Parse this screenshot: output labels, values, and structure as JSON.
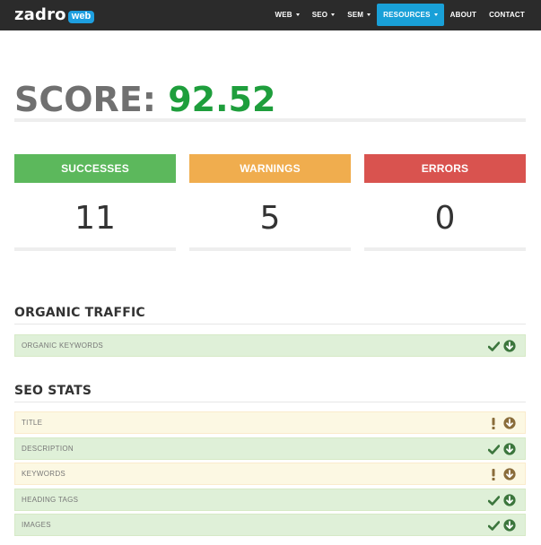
{
  "navbar": {
    "logo_text": "zadro",
    "logo_badge": "web",
    "items": [
      {
        "label": "WEB",
        "dropdown": true,
        "active": false
      },
      {
        "label": "SEO",
        "dropdown": true,
        "active": false
      },
      {
        "label": "SEM",
        "dropdown": true,
        "active": false
      },
      {
        "label": "RESOURCES",
        "dropdown": true,
        "active": true
      },
      {
        "label": "ABOUT",
        "dropdown": false,
        "active": false
      },
      {
        "label": "CONTACT",
        "dropdown": false,
        "active": false
      }
    ],
    "colors": {
      "background": "#2b2b2b",
      "active": "#19a0d8",
      "badge": "#1e9fe0"
    }
  },
  "score": {
    "label": "SCORE:",
    "value": "92.52",
    "colors": {
      "label": "#707070",
      "value": "#1e9e3c"
    }
  },
  "stats": [
    {
      "label": "SUCCESSES",
      "value": "11",
      "color": "#5cb85c"
    },
    {
      "label": "WARNINGS",
      "value": "5",
      "color": "#f0ad4e"
    },
    {
      "label": "ERRORS",
      "value": "0",
      "color": "#d9534f"
    }
  ],
  "sections": [
    {
      "title": "ORGANIC TRAFFIC",
      "rows": [
        {
          "label": "ORGANIC KEYWORDS",
          "status": "success",
          "status_icon": "check-icon",
          "toggle_icon": "expand-down-icon"
        }
      ]
    },
    {
      "title": "SEO STATS",
      "rows": [
        {
          "label": "TITLE",
          "status": "warning",
          "status_icon": "exclamation-icon",
          "toggle_icon": "expand-down-icon"
        },
        {
          "label": "DESCRIPTION",
          "status": "success",
          "status_icon": "check-icon",
          "toggle_icon": "expand-down-icon"
        },
        {
          "label": "KEYWORDS",
          "status": "warning",
          "status_icon": "exclamation-icon",
          "toggle_icon": "expand-down-icon"
        },
        {
          "label": "HEADING TAGS",
          "status": "success",
          "status_icon": "check-icon",
          "toggle_icon": "expand-down-icon"
        },
        {
          "label": "IMAGES",
          "status": "success",
          "status_icon": "check-icon",
          "toggle_icon": "expand-down-icon"
        }
      ]
    }
  ],
  "status_colors": {
    "success": "#3c763d",
    "warning": "#8a6d3b",
    "success_bg": "#dff0d8",
    "warning_bg": "#fcf8e3"
  }
}
